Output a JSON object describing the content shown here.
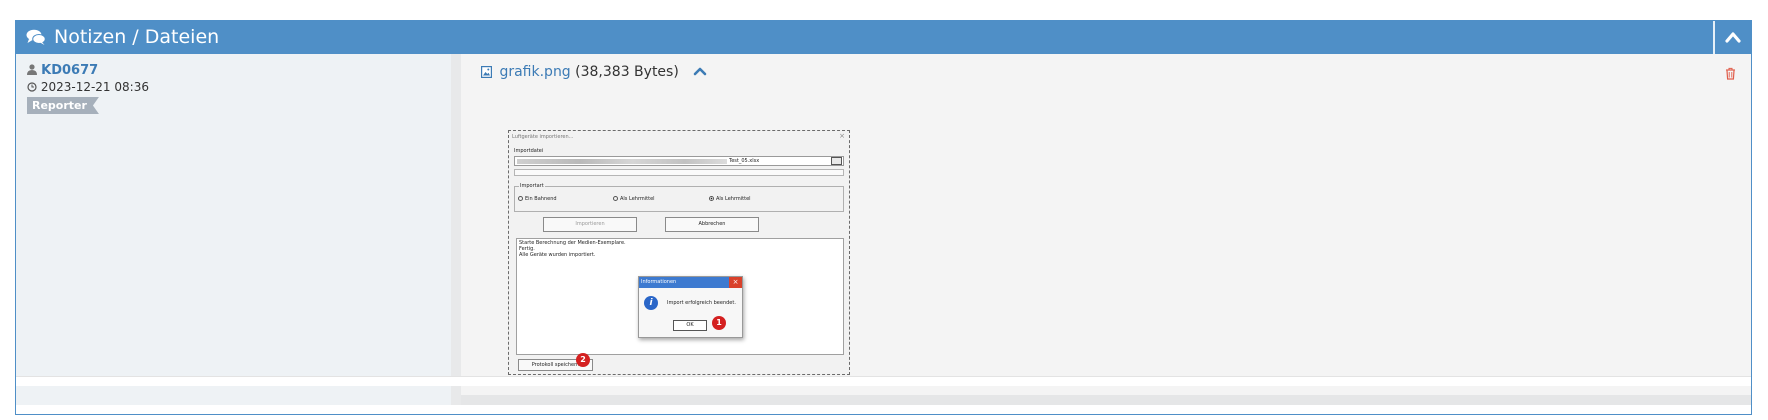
{
  "panel": {
    "title": "Notizen / Dateien",
    "icon": "comments-icon",
    "collapse_icon": "chevron-up-icon"
  },
  "note": {
    "author": "KD0677",
    "timestamp": "2023-12-21 08:36",
    "role": "Reporter"
  },
  "attachment": {
    "filename": "grafik.png",
    "size": "(38,383 Bytes)"
  },
  "screenshot": {
    "window_title": "Luftgeräte importieren...",
    "import_label": "Importdatei",
    "file_value": "Test_05.xlsx",
    "group_label": "Importart",
    "radio_options": [
      "Ein Bahnend",
      "Als Lehrmittel",
      "Als Lehrmittel"
    ],
    "selected_radio_index": 2,
    "buttons": [
      "Importieren",
      "Abbrechen"
    ],
    "log_lines": [
      "Starte Berechnung der Medien-Exemplare.",
      "Fertig.",
      "Alle Geräte wurden importiert."
    ],
    "save_button": "Protokoll speichern",
    "dialog": {
      "title": "Informationen",
      "message": "Import erfolgreich beendet.",
      "ok": "OK"
    },
    "markers": [
      "1",
      "2"
    ]
  },
  "colors": {
    "header": "#4f8fc7",
    "link": "#3c7bb5",
    "badge": "#a6b0bb",
    "delete": "#e05c4a",
    "marker": "#d42020"
  }
}
